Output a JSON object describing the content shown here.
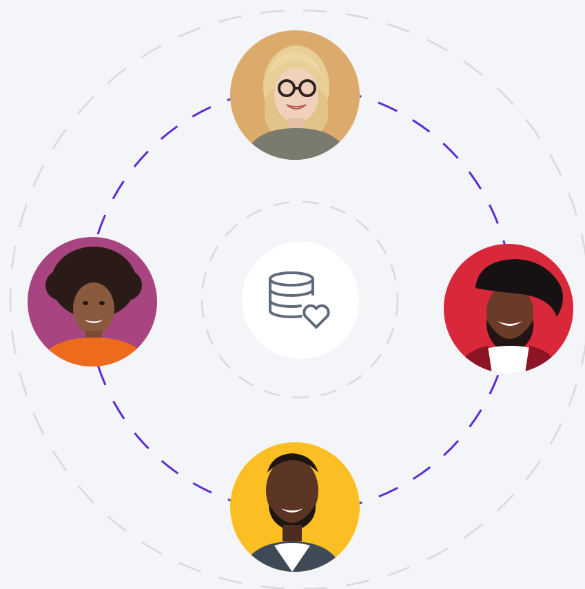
{
  "icons": {
    "center": "database-heart-icon"
  },
  "colors": {
    "background": "#f4f5f8",
    "accent_ring": "#5b2bd6",
    "outer_ring": "#d7d9de",
    "inner_ring": "#d7d9de",
    "icon": "#5f6b7a",
    "avatar_top_bg": "#dcaa6b",
    "avatar_left_bg": "#a8447f",
    "avatar_right_bg": "#d9283a",
    "avatar_bottom_bg": "#fbbf24"
  },
  "avatars": [
    {
      "name": "person-blonde-glasses"
    },
    {
      "name": "person-curly-hair-orange-sweater"
    },
    {
      "name": "person-black-hat-laughing"
    },
    {
      "name": "person-smiling-plaid-shirt"
    }
  ]
}
